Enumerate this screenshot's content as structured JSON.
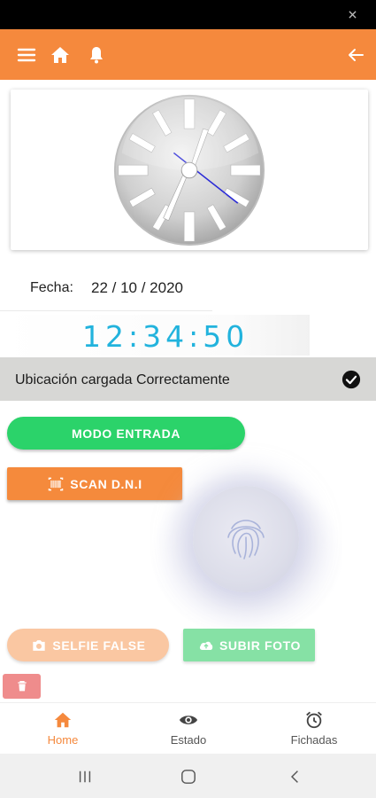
{
  "app_bar": {
    "background": "#f5893d",
    "icons": [
      "menu-icon",
      "home-icon",
      "bell-icon",
      "back-arrow-icon"
    ]
  },
  "clock": {
    "icon": "analog-clock-image"
  },
  "date": {
    "label": "Fecha:",
    "value": "22 / 10 / 2020"
  },
  "time": {
    "value": "12:34:50",
    "color": "#22b3dd"
  },
  "location": {
    "text": "Ubicación cargada Correctamente",
    "icon": "check-circle-icon"
  },
  "buttons": {
    "entrada_label": "MODO ENTRADA",
    "scan_label": "SCAN D.N.I",
    "selfie_label": "SELFIE FALSE",
    "subir_label": "SUBIR FOTO"
  },
  "fingerprint": {
    "icon": "fingerprint-icon"
  },
  "bottom_nav": {
    "items": [
      {
        "label": "Home",
        "icon": "home-icon",
        "active": true
      },
      {
        "label": "Estado",
        "icon": "eye-icon",
        "active": false
      },
      {
        "label": "Fichadas",
        "icon": "alarm-clock-icon",
        "active": false
      }
    ]
  },
  "colors": {
    "accent": "#f5893d",
    "green": "#2bd36a",
    "location_bar": "#d7d7d5",
    "delete": "#ef8c8c"
  }
}
